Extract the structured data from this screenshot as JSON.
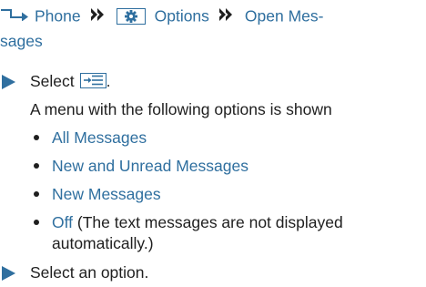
{
  "breadcrumb": {
    "phone": "Phone",
    "options": "Options",
    "open_messages_part1": "Open Mes-",
    "open_messages_part2": "sages"
  },
  "steps": {
    "step1_prefix": "Select",
    "step1_suffix": ".",
    "description": "A menu with the following options is shown",
    "step2": "Select an option."
  },
  "options": [
    {
      "label": "All Messages"
    },
    {
      "label": "New and Unread Messages"
    },
    {
      "label": "New Messages"
    },
    {
      "label": "Off",
      "note_line1": " (The text messages are not displayed",
      "note_line2": "automatically.)"
    }
  ],
  "colors": {
    "accent": "#2f6f9f",
    "text": "#1f1f1f"
  },
  "icons": {
    "nav": "phone-nav-arrow-icon",
    "separator": "double-chevron-right-icon",
    "gear": "gear-icon",
    "menu": "menu-list-icon",
    "step": "triangle-right-icon"
  }
}
